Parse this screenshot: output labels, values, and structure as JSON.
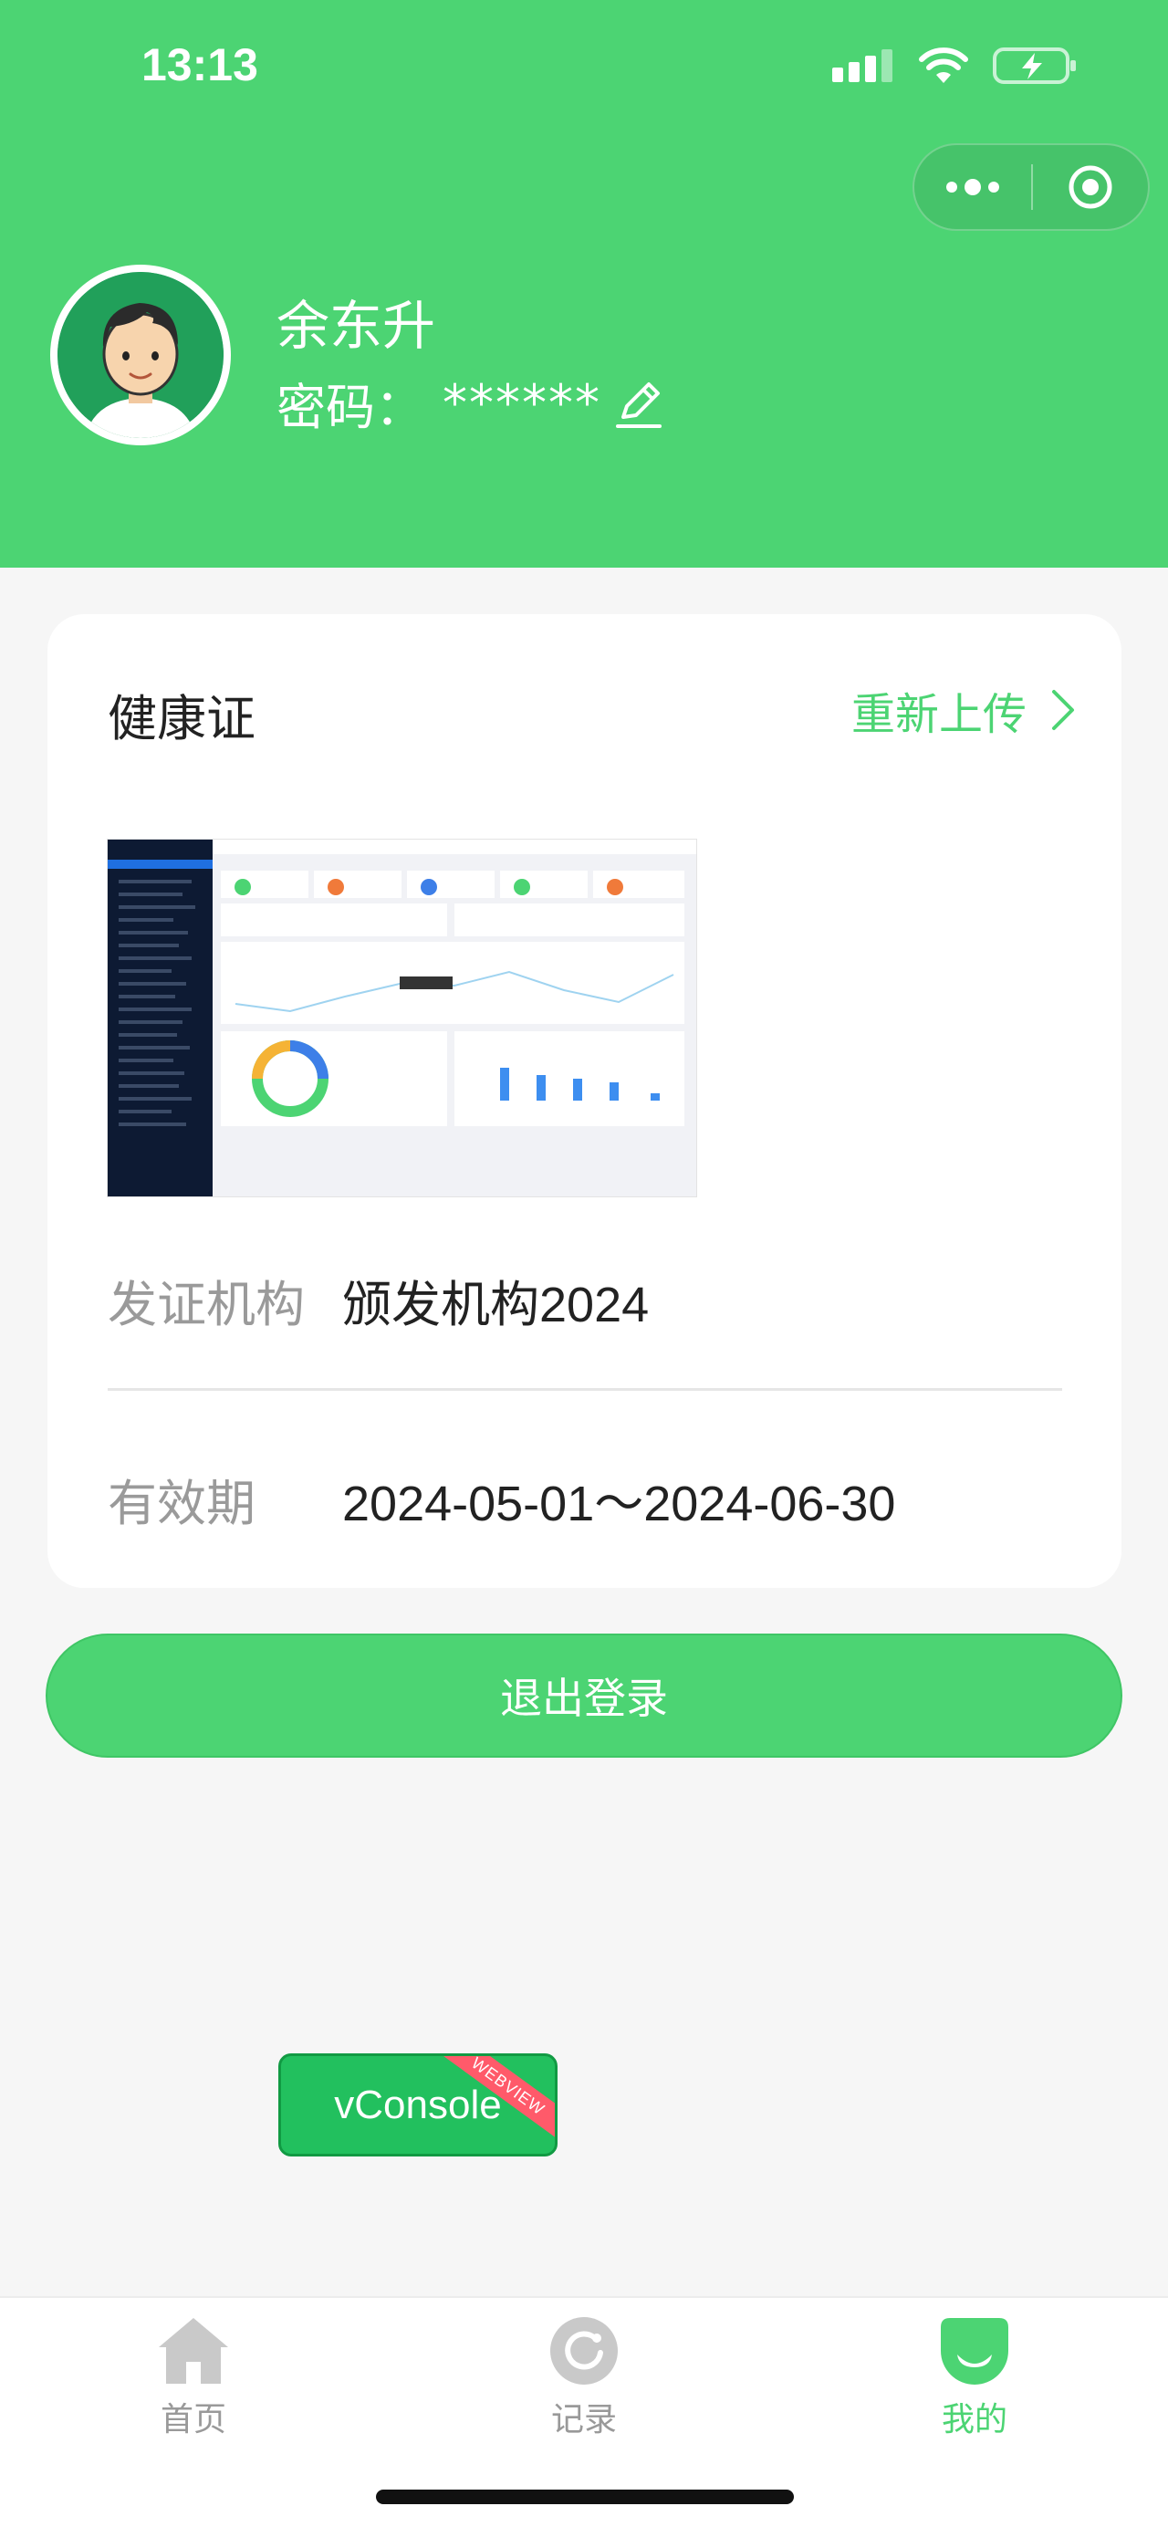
{
  "status_bar": {
    "time": "13:13"
  },
  "profile": {
    "name": "余东升",
    "password_label": "密码：",
    "password_value": "******"
  },
  "card": {
    "title": "健康证",
    "reupload_label": "重新上传",
    "issuer_label": "发证机构",
    "issuer_value": "颁发机构2024",
    "validity_label": "有效期",
    "validity_value": "2024-05-01～2024-06-30"
  },
  "logout_label": "退出登录",
  "vconsole": {
    "label": "vConsole",
    "ribbon": "WEBVIEW"
  },
  "tabbar": {
    "items": [
      {
        "label": "首页",
        "icon": "home-icon",
        "active": false
      },
      {
        "label": "记录",
        "icon": "record-icon",
        "active": false
      },
      {
        "label": "我的",
        "icon": "mine-icon",
        "active": true
      }
    ]
  },
  "colors": {
    "brand": "#4cd473",
    "inactive": "#999999"
  }
}
